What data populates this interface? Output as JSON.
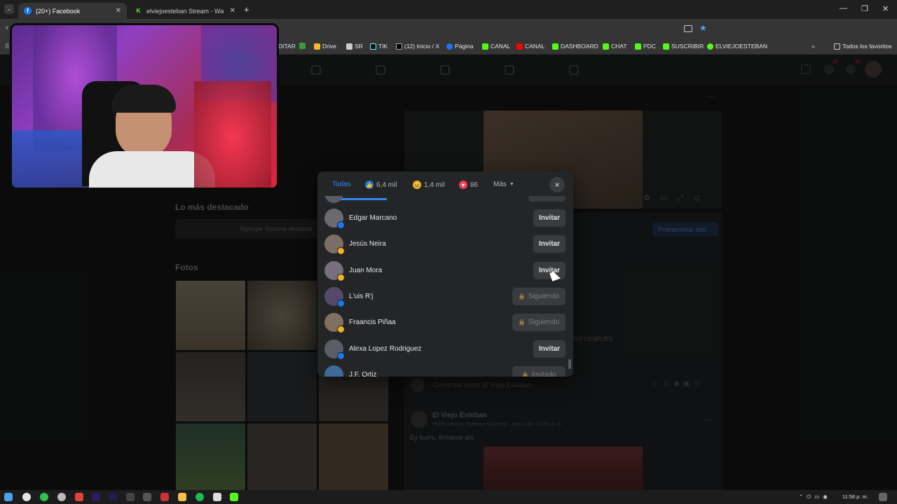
{
  "browser": {
    "tabs": [
      {
        "title": "(20+) Facebook",
        "favicon": "facebook-icon"
      },
      {
        "title": "elviejoesteban Stream - Watch",
        "favicon": "kick-icon"
      }
    ],
    "new_tab_label": "+",
    "bookmarks": [
      {
        "label": "DITAR"
      },
      {
        "label": "Drive"
      },
      {
        "label": "SR"
      },
      {
        "label": "TIK"
      },
      {
        "label": "(12) Inicio / X"
      },
      {
        "label": "Página"
      },
      {
        "label": "CANAL"
      },
      {
        "label": "CANAL"
      },
      {
        "label": "DASHBOARD"
      },
      {
        "label": "CHAT"
      },
      {
        "label": "PDC"
      },
      {
        "label": "SUSCRIBIR"
      },
      {
        "label": "ELVIEJOESTEBAN"
      }
    ],
    "all_favorites": "Todos los favoritos"
  },
  "facebook": {
    "notif_badges": {
      "messenger": "10",
      "notifications": "15"
    },
    "highlights_title": "Lo más destacado",
    "add_highlight": "Agregar historia destaca",
    "photos_title": "Fotos",
    "promote_reel": "Promocionar reel",
    "comment_placeholder": "Comentar como El Viejo Esteban",
    "post_author": "El Viejo Esteban",
    "post_meta": "Publicado por Esteban Quintero · Ayer a las 10:30 a. m.",
    "post_text": "Ey burro, firmame ahi",
    "bg_fragment": "GO DESPUES"
  },
  "reactions_modal": {
    "tabs": {
      "all": "Todas",
      "like_count": "6,4 mil",
      "haha_count": "1,4 mil",
      "love_count": "86",
      "more": "Más"
    },
    "close_label": "×",
    "people": [
      {
        "name": "Edgar Marcano",
        "reaction": "like",
        "button": "Invitar",
        "state": "invite"
      },
      {
        "name": "Jesús Neira",
        "reaction": "haha",
        "button": "Invitar",
        "state": "invite"
      },
      {
        "name": "Juan Mora",
        "reaction": "haha",
        "button": "Invitar",
        "state": "invite"
      },
      {
        "name": "L'uis R'j",
        "reaction": "like",
        "button": "Siguiendo",
        "state": "following"
      },
      {
        "name": "Fraancis Piñaa",
        "reaction": "haha",
        "button": "Siguiendo",
        "state": "following"
      },
      {
        "name": "Alexa Lopez Rodriguez",
        "reaction": "like",
        "button": "Invitar",
        "state": "invite"
      },
      {
        "name": "J.F. Ortiz",
        "reaction": "like",
        "button": "Invitado",
        "state": "invited"
      }
    ]
  },
  "taskbar": {
    "time": "11:58 p. m."
  },
  "colors": {
    "accent_blue": "#2d88ff",
    "like_blue": "#1877f2",
    "love_red": "#f33e58",
    "haha_yellow": "#f7b125"
  }
}
